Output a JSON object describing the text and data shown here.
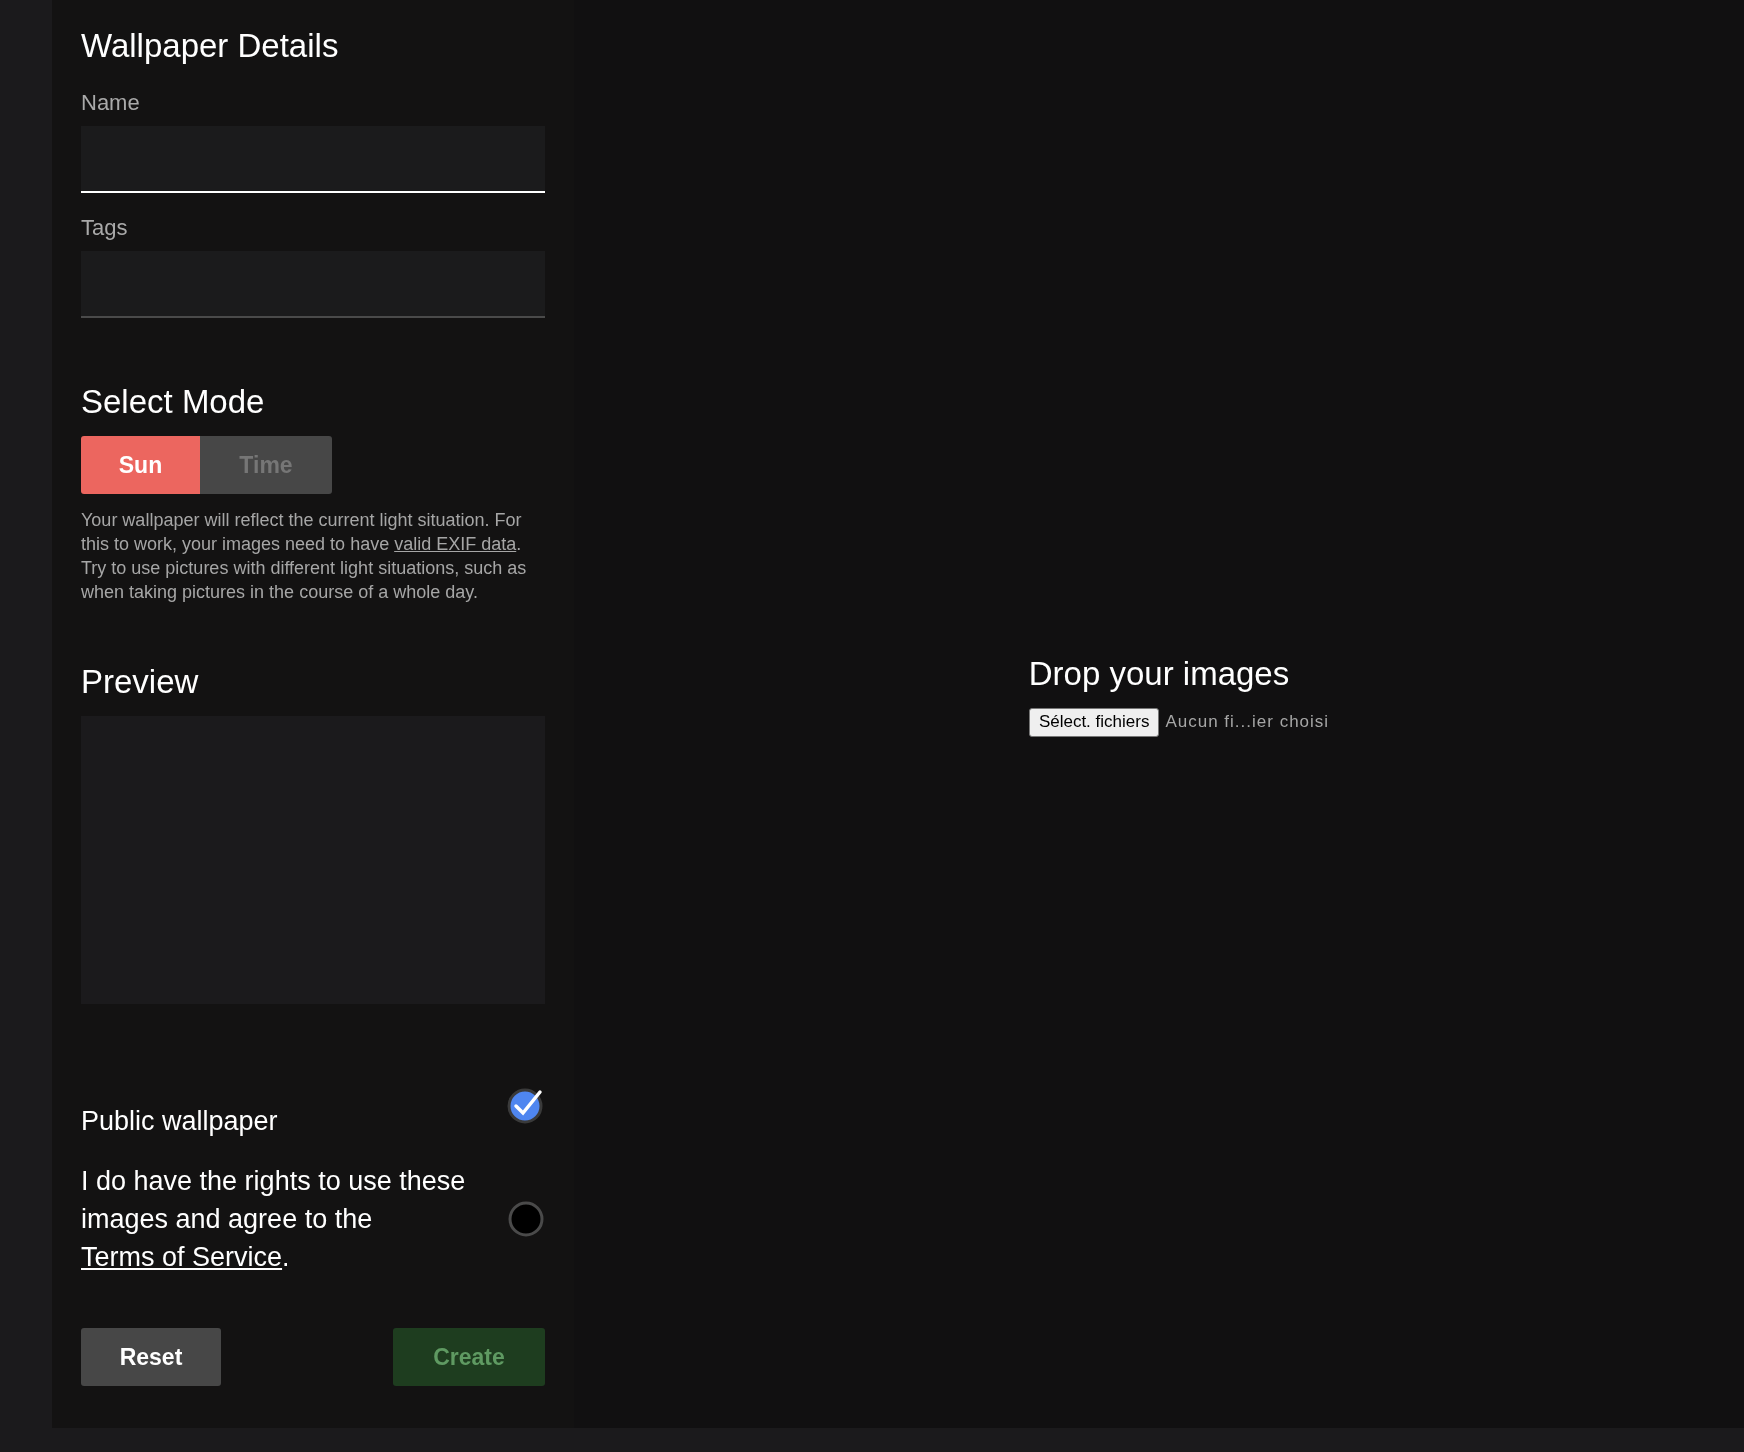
{
  "form": {
    "title": "Wallpaper Details",
    "fields": [
      {
        "label": "Name",
        "focused": true
      },
      {
        "label": "Tags",
        "focused": false
      }
    ],
    "mode": {
      "heading": "Select Mode",
      "options": [
        {
          "label": "Sun",
          "selected": true
        },
        {
          "label": "Time",
          "selected": false
        }
      ],
      "description": {
        "before": "Your wallpaper will reflect the current light situation. For this to work, your images need to have ",
        "link": "valid EXIF data",
        "after": ". Try to use pictures with different light situations, such as when taking pictures in the course of a whole day."
      }
    },
    "preview": {
      "heading": "Preview"
    },
    "checkboxes": [
      {
        "label": "Public wallpaper",
        "checked": true
      },
      {
        "label": "I do have the rights to use these images and agree to the ",
        "link": "Terms of Service",
        "after": ".",
        "checked": false
      }
    ],
    "buttons": [
      {
        "label": "Reset",
        "kind": "secondary",
        "disabled": false
      },
      {
        "label": "Create",
        "kind": "primary",
        "disabled": true
      }
    ]
  },
  "dropzone": {
    "heading": "Drop your images",
    "button": "Sélect. fichiers",
    "status": "Aucun fi...ier choisi"
  }
}
